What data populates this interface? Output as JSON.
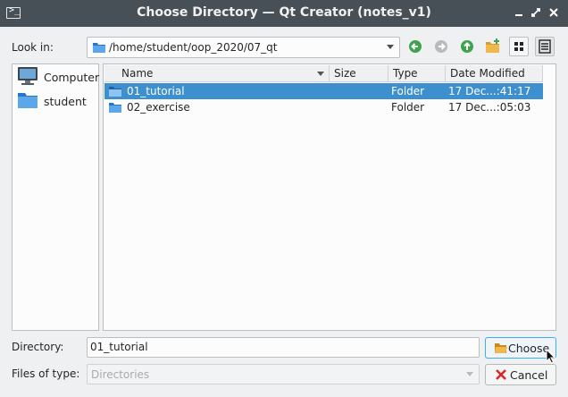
{
  "window": {
    "title": "Choose Directory — Qt Creator (notes_v1)",
    "app_icon_glyph": ">_",
    "controls": {
      "minimize": "✖",
      "maximize": "",
      "close": ""
    }
  },
  "look_in": {
    "label": "Look in:",
    "path": "/home/student/oop_2020/07_qt"
  },
  "toolbar": {
    "icons": [
      "back-arrow-icon",
      "forward-arrow-icon",
      "up-arrow-icon",
      "new-folder-icon",
      "list-view-icon",
      "detail-view-icon"
    ]
  },
  "sidebar": {
    "items": [
      {
        "label": "Computer",
        "icon": "computer-icon"
      },
      {
        "label": "student",
        "icon": "folder-icon"
      }
    ]
  },
  "file_list": {
    "columns": [
      "Name",
      "Size",
      "Type",
      "Date Modified"
    ],
    "rows": [
      {
        "name": "01_tutorial",
        "size": "",
        "type": "Folder",
        "date": "17 Dec...:41:17",
        "selected": true
      },
      {
        "name": "02_exercise",
        "size": "",
        "type": "Folder",
        "date": "17 Dec...:05:03",
        "selected": false
      }
    ]
  },
  "directory": {
    "label": "Directory:",
    "value": "01_tutorial"
  },
  "files_of_type": {
    "label": "Files of type:",
    "value": "Directories"
  },
  "buttons": {
    "choose": "Choose",
    "cancel": "Cancel"
  },
  "colors": {
    "titlebar": "#475057",
    "selection": "#3d8fcd",
    "window_bg": "#eff0f1"
  }
}
